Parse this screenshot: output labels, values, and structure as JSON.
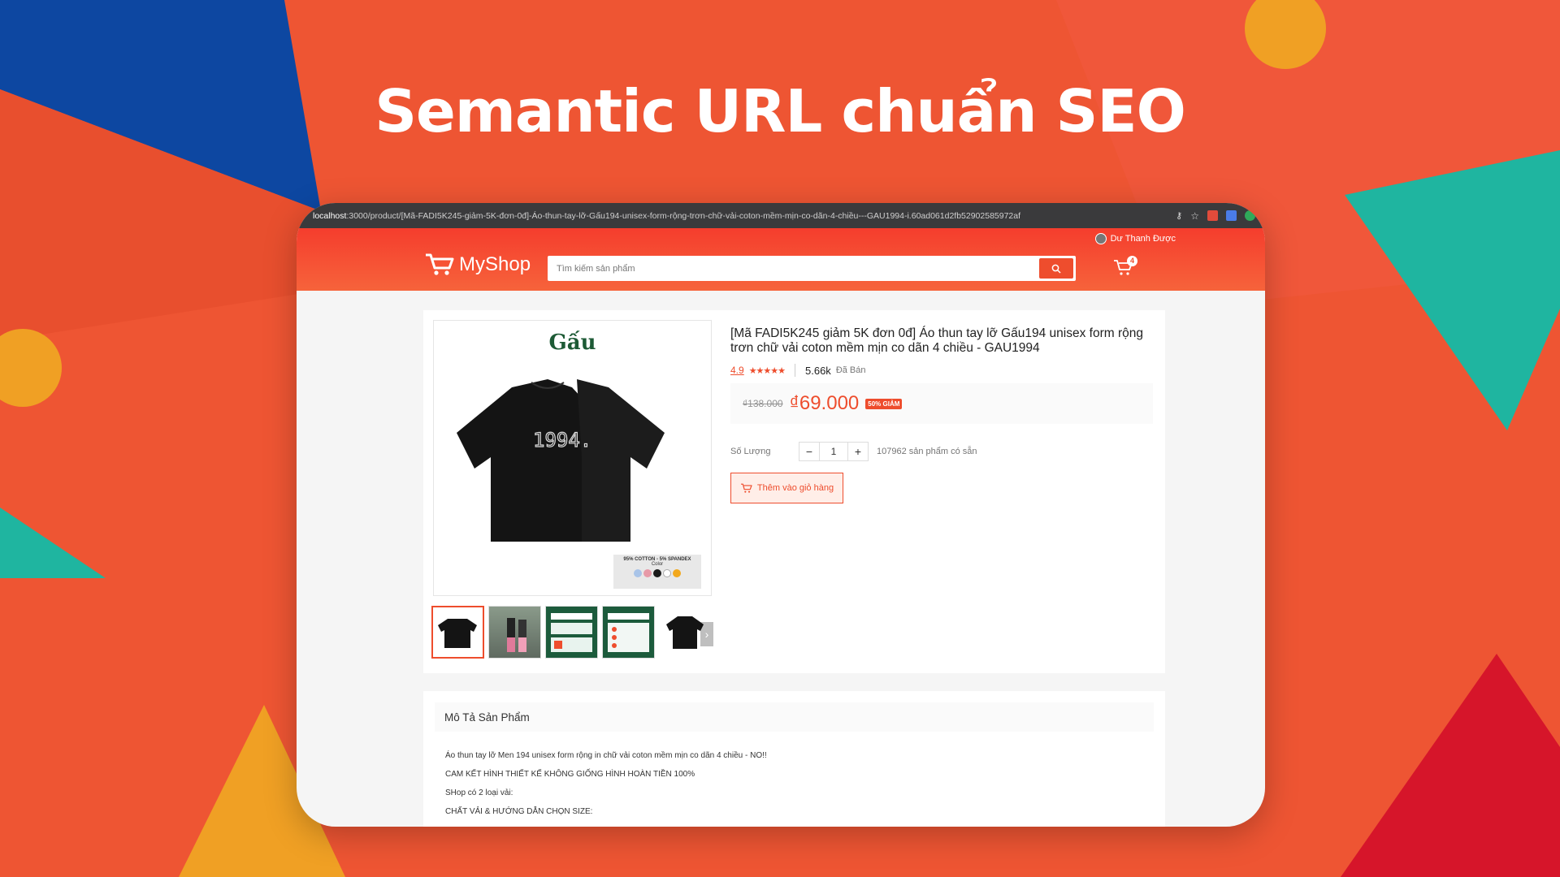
{
  "headline": "Semantic URL chuẩn SEO",
  "browser": {
    "url_host": "localhost",
    "url_path": ":3000/product/[Mã-FADI5K245-giảm-5K-đơn-0đ]-Áo-thun-tay-lỡ-Gấu194-unisex-form-rộng-trơn-chữ-vải-coton-mềm-mịn-co-dãn-4-chiều---GAU1994-i.60ad061d2fb52902585972af"
  },
  "header": {
    "user_name": "Dư Thanh Được",
    "logo_text": "MyShop",
    "search_placeholder": "Tìm kiếm sản phẩm",
    "cart_count": "4"
  },
  "product": {
    "brand_on_image": "Gấu",
    "shirt_print": "1994.",
    "fabric_tag": "95% COTTON - 5% SPANDEX",
    "color_label": "Color",
    "swatch_colors": [
      "#a9c4e8",
      "#e79aa8",
      "#1a1a1a",
      "#ffffff",
      "#f2a81d"
    ],
    "title": "[Mã FADI5K245 giảm 5K đơn 0đ] Áo thun tay lỡ Gấu194 unisex form rộng trơn chữ vải coton mềm mịn co dãn 4 chiều - GAU1994",
    "rating": "4.9",
    "stars": "★★★★★",
    "sold_count": "5.66k",
    "sold_label": "Đã Bán",
    "old_price": "₫138.000",
    "new_price": "₫69.000",
    "discount": "50% GIẢM",
    "qty_label": "Số Lượng",
    "qty_value": "1",
    "minus": "−",
    "plus": "+",
    "available": "107962 sản phẩm có sẵn",
    "add_to_cart": "Thêm vào giỏ hàng",
    "thumb_arrow": "›"
  },
  "description": {
    "heading": "Mô Tả Sản Phẩm",
    "lines": [
      "Áo thun tay lỡ Men 194 unisex form rộng in chữ vải coton mềm mịn co dãn 4 chiều - NO!!",
      "CAM KẾT HÌNH THIẾT KẾ KHÔNG GIỐNG HÌNH HOÀN TIỀN 100%",
      "SHop có 2 loại vải:",
      "CHẤT VẢI & HƯỚNG DẪN CHỌN SIZE:"
    ]
  },
  "colors": {
    "brand_orange": "#ee4d2d",
    "background": "#ee5533",
    "shape_blue": "#0d47a1",
    "shape_teal": "#1fb5a0",
    "shape_yellow": "#f0a024",
    "shape_red": "#d6152a"
  }
}
